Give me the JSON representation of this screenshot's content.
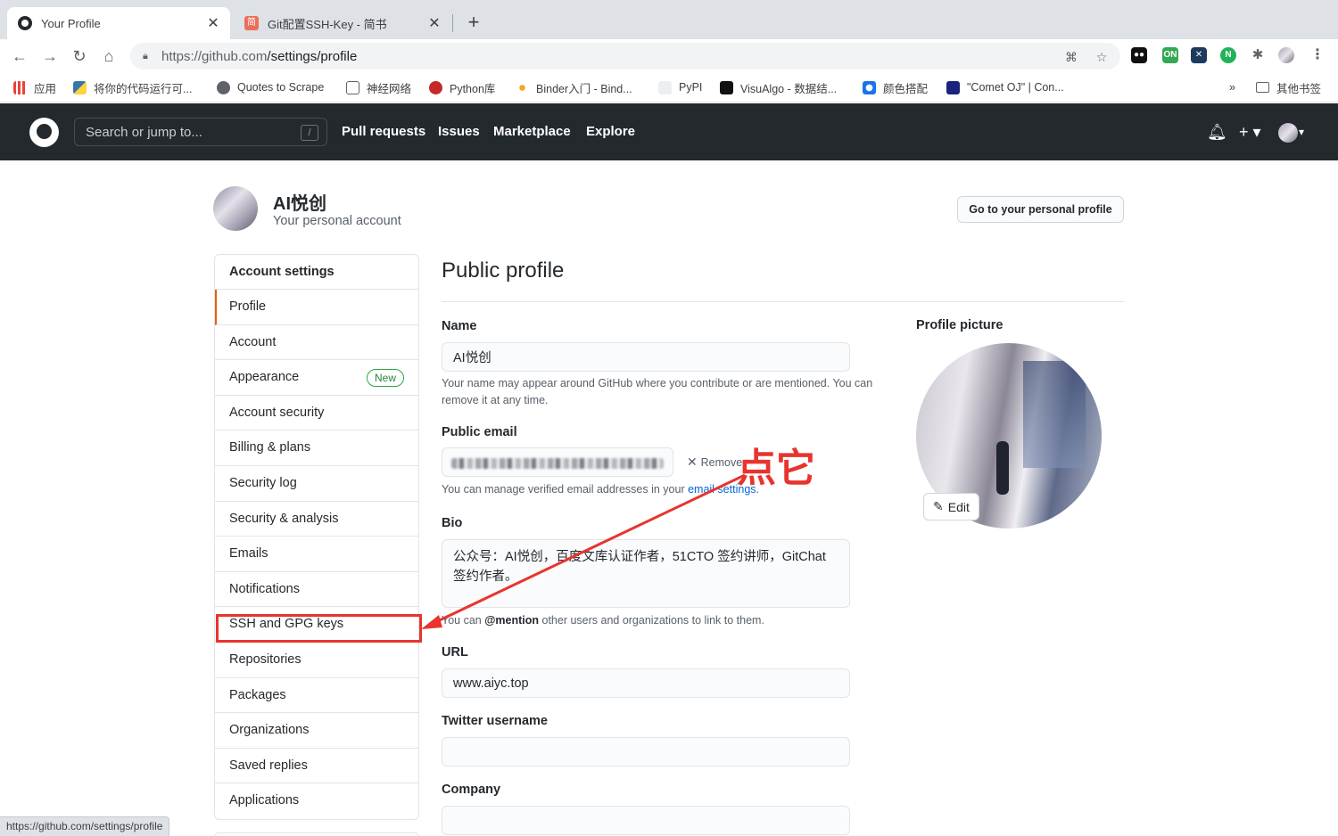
{
  "browser": {
    "tabs": [
      {
        "title": "Your Profile",
        "active": true
      },
      {
        "title": "Git配置SSH-Key - 简书",
        "active": false
      }
    ],
    "url_host": "https://github.com",
    "url_path": "/settings/profile",
    "bookmarks": [
      "应用",
      "将你的代码运行可...",
      "Quotes to Scrape",
      "神经网络",
      "Python库",
      "Binder入门 - Bind...",
      "PyPI",
      "VisuAlgo - 数据结...",
      "颜色搭配",
      "\"Comet OJ\" | Con..."
    ],
    "bookmarks_more": "»",
    "other_bookmarks": "其他书签",
    "status_url": "https://github.com/settings/profile"
  },
  "github_header": {
    "search_placeholder": "Search or jump to...",
    "search_hotkey": "/",
    "nav": [
      "Pull requests",
      "Issues",
      "Marketplace",
      "Explore"
    ]
  },
  "account": {
    "name": "AI悦创",
    "subtitle": "Your personal account",
    "profile_button": "Go to your personal profile"
  },
  "sidebar": {
    "heading": "Account settings",
    "items": [
      {
        "label": "Profile",
        "selected": true
      },
      {
        "label": "Account"
      },
      {
        "label": "Appearance",
        "badge": "New"
      },
      {
        "label": "Account security"
      },
      {
        "label": "Billing & plans"
      },
      {
        "label": "Security log"
      },
      {
        "label": "Security & analysis"
      },
      {
        "label": "Emails"
      },
      {
        "label": "Notifications"
      },
      {
        "label": "SSH and GPG keys"
      },
      {
        "label": "Repositories"
      },
      {
        "label": "Packages"
      },
      {
        "label": "Organizations"
      },
      {
        "label": "Saved replies"
      },
      {
        "label": "Applications"
      }
    ]
  },
  "main": {
    "title": "Public profile",
    "name_label": "Name",
    "name_value": "AI悦创",
    "name_note": "Your name may appear around GitHub where you contribute or are mentioned. You can remove it at any time.",
    "email_label": "Public email",
    "email_remove": "Remove",
    "email_note_prefix": "You can manage verified email addresses in your ",
    "email_note_link": "email settings",
    "email_note_suffix": ".",
    "bio_label": "Bio",
    "bio_value": "公众号：AI悦创，百度文库认证作者，51CTO 签约讲师，GitChat 签约作者。",
    "bio_note_prefix": "You can ",
    "bio_note_mention": "@mention",
    "bio_note_suffix": " other users and organizations to link to them.",
    "url_label": "URL",
    "url_value": "www.aiyc.top",
    "twitter_label": "Twitter username",
    "twitter_value": "",
    "company_label": "Company",
    "company_value": "",
    "picture_label": "Profile picture",
    "picture_edit": "Edit"
  },
  "annotation": {
    "text": "点它",
    "color": "#e8342e"
  }
}
